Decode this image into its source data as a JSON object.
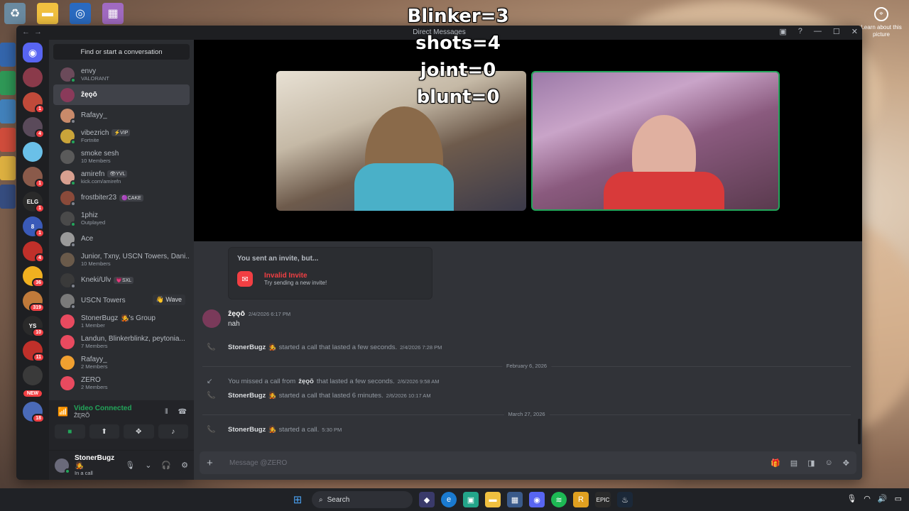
{
  "overlay": {
    "line1": "Blinker=3",
    "line2": "shots=4",
    "line3": "joint=0",
    "line4": "blunt=0"
  },
  "desktop": {
    "learn_label": "Learn about this picture"
  },
  "window": {
    "title": "Direct Messages"
  },
  "search": {
    "placeholder": "Find or start a conversation"
  },
  "dms": [
    {
      "name": "envy",
      "sub": "VALORANT",
      "color": "#6b4a5a",
      "status": "#23a55a"
    },
    {
      "name": "ẑẹǫō",
      "sub": "",
      "color": "#8a3a5a",
      "status": "",
      "active": true
    },
    {
      "name": "Rafayy_",
      "sub": "",
      "color": "#c98a6a",
      "status": "#80848e"
    },
    {
      "name": "vibezrich",
      "tag": "⚡VIP",
      "sub": "Fortnite",
      "color": "#c9a43a",
      "status": "#23a55a"
    },
    {
      "name": "smoke sesh",
      "sub": "10 Members",
      "color": "#5a5a5a",
      "status": ""
    },
    {
      "name": "amirefn",
      "tag": "👁YVL",
      "sub": "kick.com/amirefn",
      "color": "#d8a090",
      "status": "#23a55a"
    },
    {
      "name": "frostbiter23",
      "tag": "🟣CAKE",
      "sub": "",
      "color": "#8a4a3a",
      "status": "#80848e"
    },
    {
      "name": "1phiz",
      "sub": "Outplayed",
      "color": "#4a4a4a",
      "status": "#23a55a"
    },
    {
      "name": "Ace",
      "sub": "",
      "color": "#9a9a9a",
      "status": "#80848e"
    },
    {
      "name": "Junior, Txny, USCN Towers, Dani...",
      "sub": "10 Members",
      "color": "#6a5a4a",
      "status": ""
    },
    {
      "name": "Kneki/Ulv",
      "tag": "💗SXL",
      "sub": "",
      "color": "#3a3a3a",
      "status": "#80848e"
    },
    {
      "name": "USCN Towers",
      "sub": "",
      "color": "#7a7a7a",
      "status": "#80848e",
      "wave": "👋 Wave"
    },
    {
      "name": "StonerBugz 🧑‍🎤's Group",
      "sub": "1 Member",
      "color": "#e84a5f",
      "status": ""
    },
    {
      "name": "Landun, Blinkerblinkz, peytonia...",
      "sub": "7 Members",
      "color": "#e84a5f",
      "status": ""
    },
    {
      "name": "Rafayy_",
      "sub": "2 Members",
      "color": "#f0a030",
      "status": ""
    },
    {
      "name": "ZERO",
      "sub": "2 Members",
      "color": "#e84a5f",
      "status": ""
    }
  ],
  "servers": [
    {
      "color": "#8a3a4a",
      "badge": ""
    },
    {
      "color": "#c04a3a",
      "badge": "1"
    },
    {
      "color": "#5a4a5a",
      "badge": "4"
    },
    {
      "color": "#6ac0e8",
      "badge": ""
    },
    {
      "color": "#8a5a4a",
      "badge": "1"
    },
    {
      "color": "#2a2a2a",
      "badge": "1"
    },
    {
      "color": "#3a5ab8",
      "badge": "1"
    },
    {
      "color": "#c0302a",
      "badge": "4"
    },
    {
      "color": "#f0b020",
      "badge": "36"
    },
    {
      "color": "#c07a3a",
      "badge": "319"
    },
    {
      "color": "#2a2a2a",
      "badge": "10"
    },
    {
      "color": "#c0302a",
      "badge": "11"
    },
    {
      "color": "#3a3a3a",
      "badge": ""
    },
    {
      "color": "#4a6ab8",
      "badge": "18"
    }
  ],
  "server_glyphs": [
    "",
    "",
    "",
    "",
    "",
    "ELG",
    "8",
    "",
    "",
    "",
    "YS",
    "",
    "",
    ""
  ],
  "rail": {
    "new_label": "NEW"
  },
  "voice": {
    "title": "Video Connected",
    "channel": "ẐĘRÕ"
  },
  "user": {
    "name": "StonerBugz 🧑‍🎤",
    "status": "In a call"
  },
  "chat": {
    "invite_header": "You sent an invite, but...",
    "invite_title": "Invalid Invite",
    "invite_sub": "Try sending a new invite!",
    "msg_author": "ẑẹǫō",
    "msg_time": "2/4/2026 6:17 PM",
    "msg_text": "nah",
    "sys1_name": "StonerBugz 🧑‍🎤",
    "sys1_text": "started a call that lasted a few seconds.",
    "sys1_time": "2/4/2026 7:28 PM",
    "div1": "February 6, 2026",
    "sys2_pre": "You missed a call from",
    "sys2_name": "ẑẹǫō",
    "sys2_text": "that lasted a few seconds.",
    "sys2_time": "2/6/2026 9:58 AM",
    "sys3_name": "StonerBugz 🧑‍🎤",
    "sys3_text": "started a call that lasted 6 minutes.",
    "sys3_time": "2/6/2026 10:17 AM",
    "div2": "March 27, 2026",
    "sys4_name": "StonerBugz 🧑‍🎤",
    "sys4_text": "started a call.",
    "sys4_time": "5:30 PM"
  },
  "composer": {
    "placeholder": "Message @ZERO"
  },
  "taskbar": {
    "search_label": "Search"
  }
}
